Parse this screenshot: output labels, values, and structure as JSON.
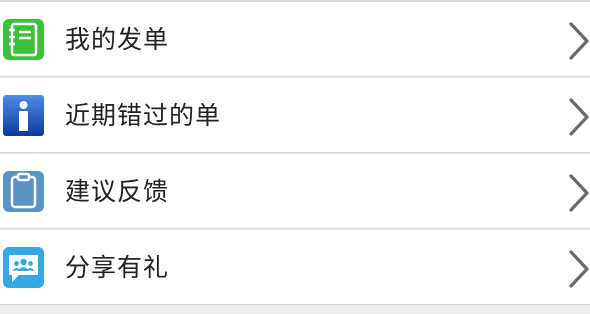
{
  "menu": {
    "items": [
      {
        "label": "我的发单",
        "icon": "green-notebook-icon"
      },
      {
        "label": "近期错过的单",
        "icon": "blue-info-icon"
      },
      {
        "label": "建议反馈",
        "icon": "clipboard-icon"
      },
      {
        "label": "分享有礼",
        "icon": "share-chat-icon"
      }
    ]
  },
  "colors": {
    "notebook_green": "#3cbf3a",
    "info_blue": "#1a4fb0",
    "clipboard_blue": "#5a93c6",
    "share_blue": "#35a7e4",
    "chevron_gray": "#6b6b6b"
  }
}
